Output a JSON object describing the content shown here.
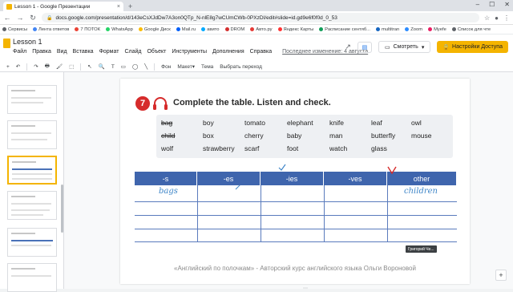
{
  "browser": {
    "tab_title": "Lesson 1 - Google Презентации",
    "tab_close": "×",
    "new_tab": "+",
    "window_controls": [
      "–",
      "☐",
      "✕"
    ],
    "url": "docs.google.com/presentation/d/143eCsXJdDw7A3on0QTp_N-nlE8g7wCUmCWb-0PXzDI/edit#slide=id.gd9e6f0f0d_0_53",
    "nav": [
      "←",
      "→",
      "↻"
    ]
  },
  "bookmarks": [
    {
      "label": "Сервисы",
      "color": "#5f6368"
    },
    {
      "label": "Лента ответов",
      "color": "#4285f4"
    },
    {
      "label": "7 ПОТОК",
      "color": "#ea4335"
    },
    {
      "label": "WhatsApp",
      "color": "#25d366"
    },
    {
      "label": "Google Диск",
      "color": "#fbbc04"
    },
    {
      "label": "Mail.ru",
      "color": "#005ff9"
    },
    {
      "label": "авито",
      "color": "#00aaff"
    },
    {
      "label": "DROM",
      "color": "#d32f2f"
    },
    {
      "label": "Авто.ру",
      "color": "#e53935"
    },
    {
      "label": "Яндекс Карты",
      "color": "#ff3333"
    },
    {
      "label": "Расписание сентяб...",
      "color": "#0f9d58"
    },
    {
      "label": "multitran",
      "color": "#1565c0"
    },
    {
      "label": "Zoom",
      "color": "#2d8cff"
    },
    {
      "label": "Myefe",
      "color": "#e91e63"
    },
    {
      "label": "Список для чте",
      "color": "#5f6368"
    }
  ],
  "slides_app": {
    "doc_title": "Lesson 1",
    "menu": [
      "Файл",
      "Правка",
      "Вид",
      "Вставка",
      "Формат",
      "Слайд",
      "Объект",
      "Инструменты",
      "Дополнения",
      "Справка"
    ],
    "last_edit": "Последнее изменение: 4 августа",
    "present_label": "Смотреть",
    "share_label": "Настройки Доступа",
    "toolbar": [
      "+",
      "↶",
      "↷",
      "🖶",
      "🖌",
      "⬚",
      "↖",
      "🔍",
      "T",
      "▭",
      "◯",
      "╲",
      "Фон",
      "Макет▾",
      "Тема",
      "Выбрать переход"
    ]
  },
  "slide": {
    "exercise_number": "7",
    "title": "Complete the table. Listen and check.",
    "words": [
      {
        "text": "bag",
        "struck": true
      },
      {
        "text": "boy",
        "struck": false
      },
      {
        "text": "tomato",
        "struck": false
      },
      {
        "text": "elephant",
        "struck": false
      },
      {
        "text": "knife",
        "struck": false
      },
      {
        "text": "leaf",
        "struck": false
      },
      {
        "text": "owl",
        "struck": false
      },
      {
        "text": "child",
        "struck": true
      },
      {
        "text": "box",
        "struck": false
      },
      {
        "text": "cherry",
        "struck": false
      },
      {
        "text": "baby",
        "struck": false
      },
      {
        "text": "man",
        "struck": false
      },
      {
        "text": "butterfly",
        "struck": false
      },
      {
        "text": "mouse",
        "struck": false
      },
      {
        "text": "wolf",
        "struck": false
      },
      {
        "text": "strawberry",
        "struck": false
      },
      {
        "text": "scarf",
        "struck": false
      },
      {
        "text": "foot",
        "struck": false
      },
      {
        "text": "watch",
        "struck": false
      },
      {
        "text": "glass",
        "struck": false
      }
    ],
    "table_headers": [
      "-s",
      "-es",
      "-ies",
      "-ves",
      "other"
    ],
    "handwritten": [
      "bags",
      "children"
    ],
    "tooltip": "Григорий Че...",
    "caption": "«Английский по полочкам» - Авторский курс английского языка Ольги Вороновой",
    "page_dots": "⋯"
  },
  "colors": {
    "accent": "#f4b400",
    "table_header": "#3f65ad",
    "handwriting": "#3f86c8",
    "exercise_badge": "#d62b2b"
  }
}
